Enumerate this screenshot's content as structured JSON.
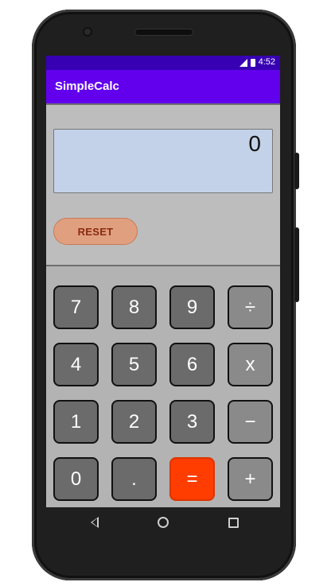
{
  "status_bar": {
    "time": "4:52",
    "signal_icon": "signal-icon",
    "battery_icon": "battery-icon"
  },
  "app_bar": {
    "title": "SimpleCalc"
  },
  "display": {
    "value": "0"
  },
  "reset_button": {
    "label": "RESET"
  },
  "keypad": {
    "row1": [
      "7",
      "8",
      "9",
      "÷"
    ],
    "row2": [
      "4",
      "5",
      "6",
      "x"
    ],
    "row3": [
      "1",
      "2",
      "3",
      "−"
    ],
    "row4": [
      "0",
      ".",
      "=",
      "+"
    ]
  },
  "nav_bar": {
    "back_icon": "back-icon",
    "home_icon": "home-icon",
    "recents_icon": "recents-icon"
  },
  "colors": {
    "status_bar": "#3700b3",
    "app_bar": "#6200ee",
    "display_bg": "#c3d2e8",
    "equals_key": "#ff3d00",
    "reset_bg": "#e0a080"
  }
}
